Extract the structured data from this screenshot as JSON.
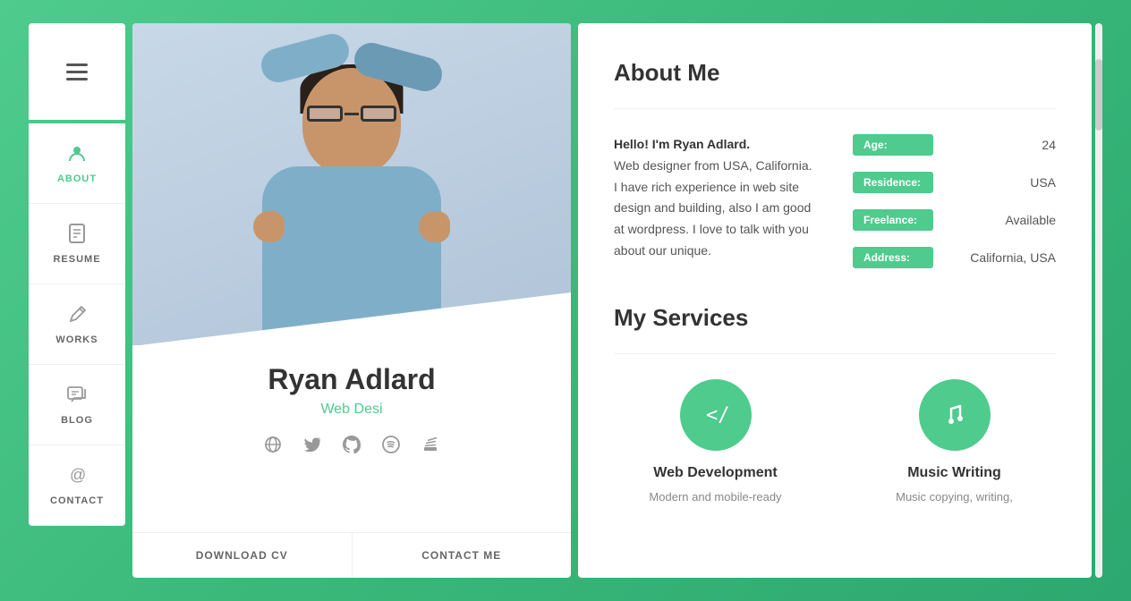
{
  "sidebar": {
    "hamburger_label": "menu",
    "nav_items": [
      {
        "id": "about",
        "label": "ABOUT",
        "icon": "person",
        "active": true
      },
      {
        "id": "resume",
        "label": "RESUME",
        "icon": "doc"
      },
      {
        "id": "works",
        "label": "WORKS",
        "icon": "pencil"
      },
      {
        "id": "blog",
        "label": "BLOG",
        "icon": "chat"
      },
      {
        "id": "contact",
        "label": "CONTACT",
        "icon": "at"
      }
    ]
  },
  "profile": {
    "name": "Ryan Adlard",
    "title": "Web Desi",
    "social_icons": [
      "globe",
      "twitter",
      "github",
      "spotify",
      "stack"
    ],
    "download_cv": "DOWNLOAD CV",
    "contact_me": "CONTACT ME"
  },
  "about": {
    "section_title": "About Me",
    "intro_bold": "Hello! I'm Ryan Adlard.",
    "intro_text": "Web designer from USA, California. I have rich experience in web site design and building, also I am good at wordpress. I love to talk with you about our unique.",
    "details": [
      {
        "label": "Age:",
        "value": "24"
      },
      {
        "label": "Residence:",
        "value": "USA"
      },
      {
        "label": "Freelance:",
        "value": "Available"
      },
      {
        "label": "Address:",
        "value": "California, USA"
      }
    ]
  },
  "services": {
    "section_title": "My Services",
    "items": [
      {
        "icon": "code",
        "name": "Web Development",
        "desc": "Modern and mobile-ready"
      },
      {
        "icon": "music",
        "name": "Music Writing",
        "desc": "Music copying, writing,"
      }
    ]
  },
  "colors": {
    "accent": "#4ecb8d",
    "text_dark": "#333",
    "text_medium": "#555",
    "text_light": "#999"
  }
}
